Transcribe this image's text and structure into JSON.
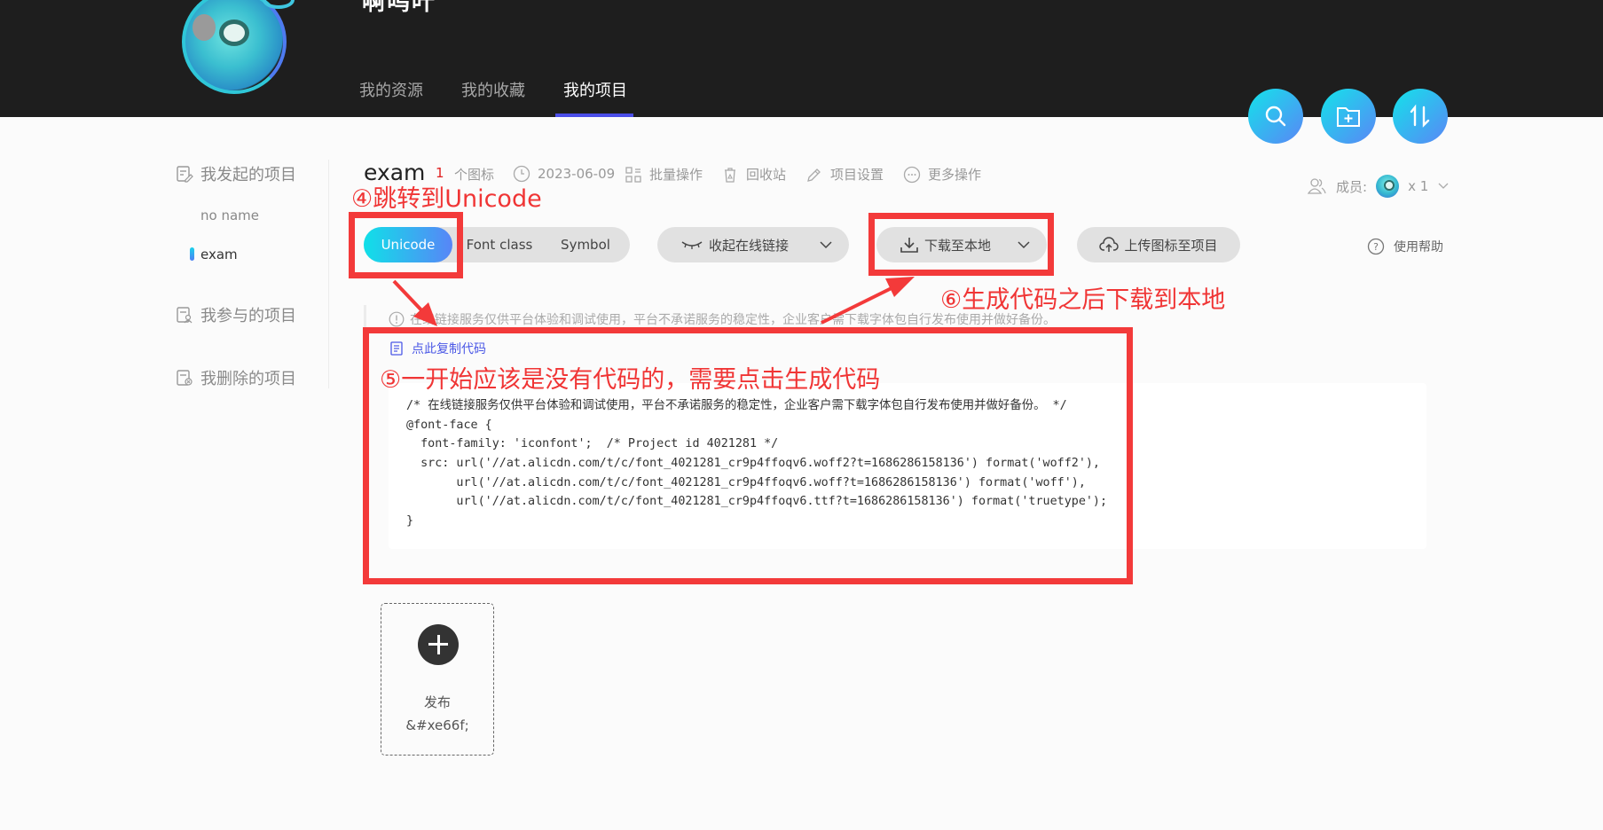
{
  "header": {
    "username": "啊呜叶",
    "tabs": [
      {
        "label": "我的资源",
        "active": false
      },
      {
        "label": "我的收藏",
        "active": false
      },
      {
        "label": "我的项目",
        "active": true
      }
    ],
    "actions": [
      {
        "icon": "search-icon"
      },
      {
        "icon": "folder-add-icon"
      },
      {
        "icon": "sort-icon"
      }
    ],
    "accent_color": "#4b4ee8"
  },
  "sidebar": {
    "groups": [
      {
        "label": "我发起的项目",
        "icon": "edit-doc-icon"
      },
      {
        "label": "我参与的项目",
        "icon": "user-doc-icon"
      },
      {
        "label": "我删除的项目",
        "icon": "deleted-doc-icon"
      }
    ],
    "projects": [
      {
        "label": "no name",
        "active": false
      },
      {
        "label": "exam",
        "active": true
      }
    ]
  },
  "project": {
    "title": "exam",
    "icon_count": "1",
    "icon_count_unit": "个图标",
    "date": "2023-06-09",
    "batch_label": "批量操作",
    "recycle_label": "回收站",
    "settings_label": "项目设置",
    "more_label": "更多操作",
    "members_label": "成员:",
    "members_count": "x 1"
  },
  "toolbar": {
    "formats": [
      "Unicode",
      "Font class",
      "Symbol"
    ],
    "active_format": "Unicode",
    "collapse_link_label": "收起在线链接",
    "download_label": "下载至本地",
    "upload_label": "上传图标至项目",
    "help_label": "使用帮助"
  },
  "notice": "在线链接服务仅供平台体验和调试使用，平台不承诺服务的稳定性，企业客户需下载字体包自行发布使用并做好备份。",
  "copy_code_label": "点此复制代码",
  "code_lines": [
    "/* 在线链接服务仅供平台体验和调试使用，平台不承诺服务的稳定性，企业客户需下载字体包自行发布使用并做好备份。 */",
    "@font-face {",
    "  font-family: 'iconfont';  /* Project id 4021281 */",
    "  src: url('//at.alicdn.com/t/c/font_4021281_cr9p4ffoqv6.woff2?t=1686286158136') format('woff2'),",
    "       url('//at.alicdn.com/t/c/font_4021281_cr9p4ffoqv6.woff?t=1686286158136') format('woff'),",
    "       url('//at.alicdn.com/t/c/font_4021281_cr9p4ffoqv6.ttf?t=1686286158136') format('truetype');",
    "}"
  ],
  "icon_card": {
    "name": "发布",
    "code": "&#xe66f;"
  },
  "annotations": {
    "step4": "④跳转到Unicode",
    "step5": "⑤一开始应该是没有代码的，需要点击生成代码",
    "step6": "⑥生成代码之后下载到本地",
    "color": "#f33a3a"
  }
}
